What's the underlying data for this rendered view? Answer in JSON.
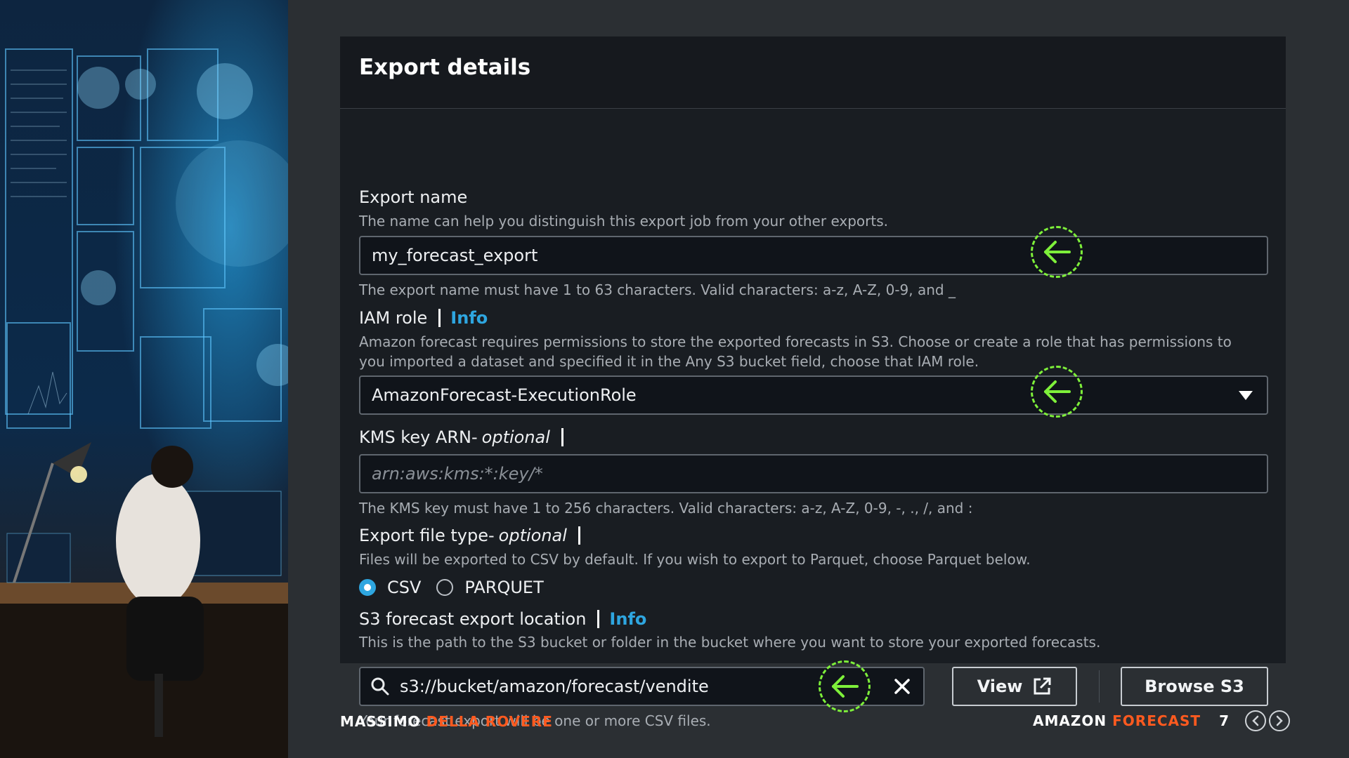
{
  "panel": {
    "title": "Export details"
  },
  "export_name": {
    "label": "Export name",
    "description": "The name can help you distinguish this export job from your other exports.",
    "value": "my_forecast_export",
    "constraint": "The export name must have 1 to 63 characters. Valid characters: a-z, A-Z, 0-9, and _"
  },
  "iam_role": {
    "label": "IAM role",
    "info": "Info",
    "description_line1": "Amazon forecast requires permissions to store the exported forecasts in S3. Choose or create a role that has permissions to",
    "description_line2": "you imported a dataset and specified it in the Any S3 bucket field, choose that IAM role.",
    "selected": "AmazonForecast-ExecutionRole"
  },
  "kms_key": {
    "label": "KMS key ARN-",
    "optional": "optional",
    "placeholder": "arn:aws:kms:*:key/*",
    "constraint": "The KMS key must have 1 to 256 characters. Valid characters: a-z, A-Z, 0-9, -, ., /, and :"
  },
  "file_type": {
    "label": "Export file type-",
    "optional": "optional",
    "description": "Files will be exported to CSV by default. If you wish to export to Parquet, choose Parquet below.",
    "options": [
      "CSV",
      "PARQUET"
    ],
    "selected": "CSV"
  },
  "s3_location": {
    "label": "S3 forecast export location",
    "info": "Info",
    "description": "This is the path to the S3 bucket or folder in the bucket where you want to store your exported forecasts.",
    "value": "s3://bucket/amazon/forecast/vendite",
    "view_label": "View",
    "browse_label": "Browse S3",
    "note": "Your forecast export will be one or more CSV files."
  },
  "footer": {
    "author_first": "MASSIMO",
    "author_last": "DELLA ROVERE",
    "topic_first": "AMAZON",
    "topic_last": "FORECAST",
    "page": "7"
  },
  "colors": {
    "accent": "#2ea6e0",
    "brand": "#ff5a1f",
    "marker": "#7ef03a"
  }
}
